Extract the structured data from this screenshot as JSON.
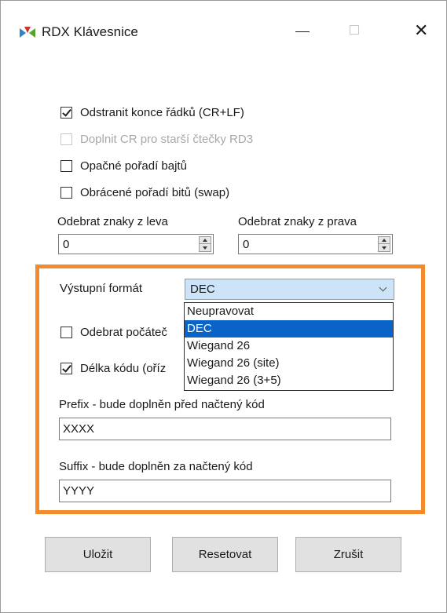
{
  "window": {
    "title": "RDX Klávesnice",
    "icon": "rdx-logo-icon",
    "controls": [
      "minimize-icon",
      "maximize-icon",
      "close-icon"
    ],
    "close_glyph": "✕"
  },
  "options": {
    "remove_line_endings": {
      "label": "Odstranit konce řádků (CR+LF)",
      "checked": true,
      "enabled": true
    },
    "add_cr_rd3": {
      "label": "Doplnit CR pro starší čtečky RD3",
      "checked": false,
      "enabled": false
    },
    "reverse_bytes": {
      "label": "Opačné pořadí bajtů",
      "checked": false,
      "enabled": true
    },
    "reverse_bits": {
      "label": "Obrácené pořadí bitů (swap)",
      "checked": false,
      "enabled": true
    }
  },
  "trim": {
    "left_label": "Odebrat znaky z leva",
    "left_value": "0",
    "right_label": "Odebrat znaky z prava",
    "right_value": "0"
  },
  "format": {
    "label": "Výstupní formát",
    "selected": "DEC",
    "options": [
      "Neupravovat",
      "DEC",
      "Wiegand 26",
      "Wiegand 26 (site)",
      "Wiegand 26 (3+5)"
    ],
    "highlighted_index": 1
  },
  "extra": {
    "remove_leading": {
      "label": "Odebrat počáteč",
      "checked": false
    },
    "code_length": {
      "label": "Délka kódu (oříz",
      "checked": true
    }
  },
  "prefix": {
    "label": "Prefix - bude doplněn před načtený kód",
    "value": "XXXX"
  },
  "suffix": {
    "label": "Suffix - bude doplněn za načtený kód",
    "value": "YYYY"
  },
  "buttons": {
    "save": "Uložit",
    "reset": "Resetovat",
    "cancel": "Zrušit"
  },
  "colors": {
    "highlight_border": "#f48a2c",
    "selection": "#0a64c8",
    "combo_bg": "#cde3f7"
  }
}
